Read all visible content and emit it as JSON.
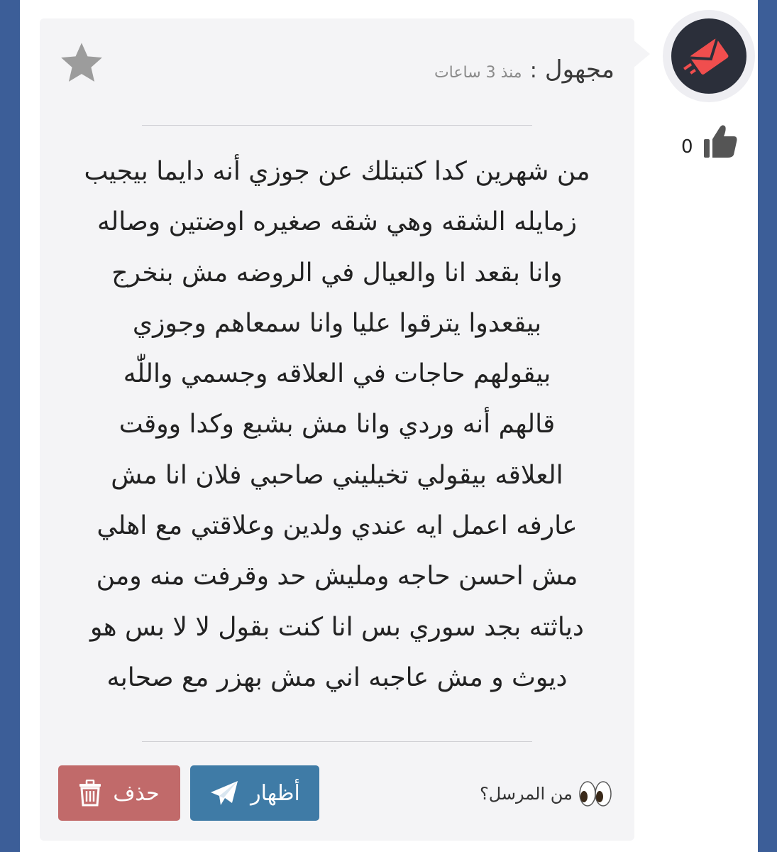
{
  "post": {
    "author": "مجهول",
    "separator": ":",
    "time": "منذ 3 ساعات",
    "message_lines": [
      "من شهرين كدا كتبتلك عن جوزي أنه دايما بيجيب",
      "زمايله الشقه وهي شقه صغيره اوضتين وصاله",
      "وانا بقعد انا والعيال في الروضه مش بنخرج",
      "بيقعدوا يترقوا عليا وانا سمعاهم وجوزي",
      "بيقولهم حاجات في العلاقه وجسمي واللّٰه",
      "قالهم أنه وردي وانا مش بشبع وكدا ووقت",
      "العلاقه بيقولي تخيليني صاحبي فلان انا مش",
      "عارفه اعمل ايه عندي ولدين وعلاقتي مع اهلي",
      "مش احسن حاجه ومليش حد وقرفت منه ومن",
      "دياثته بجد سوري بس انا كنت بقول لا لا بس هو",
      "ديوث و مش عاجبه اني مش بهزر مع صحابه"
    ]
  },
  "likes": {
    "count": "0"
  },
  "actions": {
    "reveal_label": "أظهار",
    "delete_label": "حذف",
    "sender_question": "من المرسل؟"
  },
  "icons": {
    "avatar": "envelope-logo-icon",
    "like": "thumbs-up-icon",
    "favorite": "star-icon",
    "reveal": "paper-plane-icon",
    "delete": "trash-icon",
    "sender": "eyes-emoji-icon"
  },
  "colors": {
    "background": "#3c5e98",
    "card": "#f4f4f6",
    "reveal_button": "#3f7ba6",
    "delete_button": "#c16a6a",
    "avatar_accent": "#f04e4e"
  }
}
